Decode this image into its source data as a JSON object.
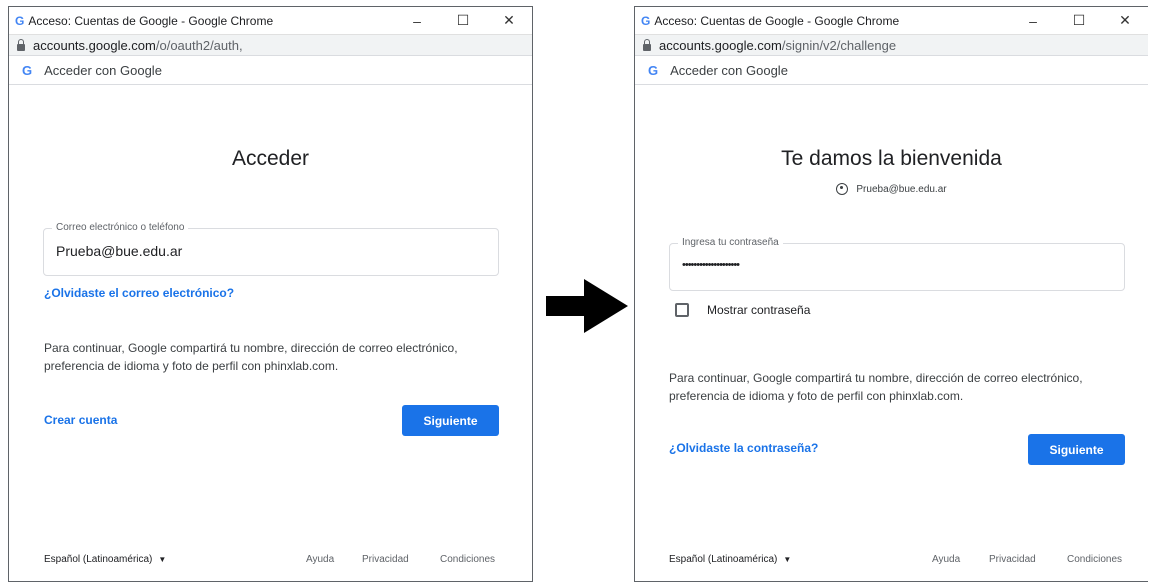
{
  "left": {
    "window_title": "Acceso: Cuentas de Google - Google Chrome",
    "url_host": "accounts.google.com",
    "url_path": "/o/oauth2/auth,",
    "tab_label": "Acceder con Google",
    "heading": "Acceder",
    "field_label": "Correo electrónico o teléfono",
    "field_value": "Prueba@bue.edu.ar",
    "forgot_link": "¿Olvidaste el correo electrónico?",
    "note_line1": "Para continuar, Google compartirá tu nombre, dirección de correo electrónico,",
    "note_line2": "preferencia de idioma y foto de perfil con phinxlab.com.",
    "create_link": "Crear cuenta",
    "next_button": "Siguiente",
    "language": "Español (Latinoamérica)",
    "help": "Ayuda",
    "privacy": "Privacidad",
    "terms": "Condiciones"
  },
  "right": {
    "window_title": "Acceso: Cuentas de Google - Google Chrome",
    "url_host": "accounts.google.com",
    "url_path": "/signin/v2/challenge",
    "tab_label": "Acceder con Google",
    "heading": "Te damos la bienvenida",
    "user_email": "Prueba@bue.edu.ar",
    "field_label": "Ingresa tu contraseña",
    "field_value": "••••••••••••••••••••",
    "show_password": "Mostrar contraseña",
    "note_line1": "Para continuar, Google compartirá tu nombre, dirección de correo electrónico,",
    "note_line2": "preferencia de idioma y foto de perfil con phinxlab.com.",
    "forgot_link": "¿Olvidaste la contraseña?",
    "next_button": "Siguiente",
    "language": "Español (Latinoamérica)",
    "help": "Ayuda",
    "privacy": "Privacidad",
    "terms": "Condiciones"
  },
  "window_controls": {
    "minimize": "–",
    "maximize": "☐",
    "close": "✕"
  },
  "google_g": "G",
  "colors": {
    "accent": "#1a73e8",
    "border": "#dadce0",
    "text": "#202124"
  }
}
